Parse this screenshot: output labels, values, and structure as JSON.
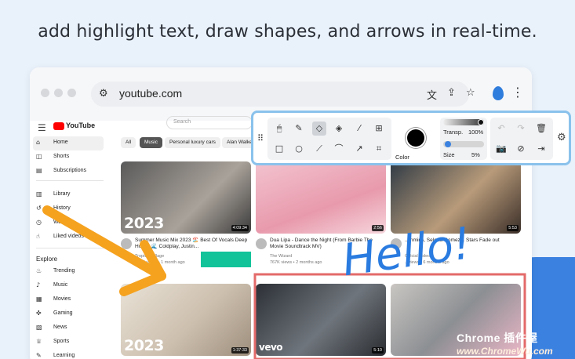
{
  "headline": "add highlight text, draw shapes, and arrows in real-time.",
  "browser": {
    "url": "youtube.com",
    "url_left_icon": "tune-icon",
    "right_icons": [
      "translate-icon",
      "share-icon",
      "star-icon",
      "extension-drop-icon",
      "more-vert-icon"
    ]
  },
  "youtube": {
    "logo_text": "YouTube",
    "search_placeholder": "Search",
    "sidebar": {
      "main": [
        {
          "label": "Home",
          "icon": "home-icon",
          "glyph": "⌂"
        },
        {
          "label": "Shorts",
          "icon": "shorts-icon",
          "glyph": "◫"
        },
        {
          "label": "Subscriptions",
          "icon": "subscriptions-icon",
          "glyph": "▤"
        }
      ],
      "library": [
        {
          "label": "Library",
          "icon": "library-icon",
          "glyph": "▥"
        },
        {
          "label": "History",
          "icon": "history-icon",
          "glyph": "↺"
        },
        {
          "label": "Watch",
          "icon": "watch-later-icon",
          "glyph": "◷"
        },
        {
          "label": "Liked videos",
          "icon": "like-icon",
          "glyph": "☝"
        }
      ],
      "explore_heading": "Explore",
      "explore": [
        {
          "label": "Trending",
          "icon": "trending-icon",
          "glyph": "♨"
        },
        {
          "label": "Music",
          "icon": "music-icon",
          "glyph": "♪"
        },
        {
          "label": "Movies",
          "icon": "movies-icon",
          "glyph": "▦"
        },
        {
          "label": "Gaming",
          "icon": "gaming-icon",
          "glyph": "✜"
        },
        {
          "label": "News",
          "icon": "news-icon",
          "glyph": "▧"
        },
        {
          "label": "Sports",
          "icon": "sports-icon",
          "glyph": "♕"
        },
        {
          "label": "Learning",
          "icon": "learning-icon",
          "glyph": "✎"
        }
      ]
    },
    "chips": [
      "All",
      "Music",
      "Personal luxury cars",
      "Alan Walker"
    ],
    "videos": [
      {
        "title": "Summer Music Mix 2023 🏖️ Best Of Vocals Deep House 🌊 Coldplay, Justin...",
        "channel": "Tropical Village",
        "meta": "271K views • 1 month ago",
        "duration": "4:09:34",
        "overlay": "2023"
      },
      {
        "title": "Dua Lipa - Dance the Night (From Barbie The Movie Soundtrack MV)",
        "channel": "The Wizard",
        "meta": "767K views • 2 months ago",
        "duration": "2:56",
        "overlay": ""
      },
      {
        "title": "...inmins, Selena Gomez... Stars Fade out",
        "channel": "Official Video",
        "meta": "...views • 6 months ago",
        "duration": "5:53",
        "overlay": ""
      },
      {
        "title": "",
        "channel": "",
        "meta": "",
        "duration": "1:37:33",
        "overlay": "2023"
      },
      {
        "title": "",
        "channel": "",
        "meta": "",
        "duration": "5:10",
        "overlay": "vevo"
      },
      {
        "title": "",
        "channel": "",
        "meta": "",
        "duration": "",
        "overlay": ""
      }
    ]
  },
  "toolbar": {
    "tools_row1": [
      "mouse-icon",
      "pencil-icon",
      "eraser-icon",
      "fill-icon",
      "eyedropper-icon",
      "text-box-icon"
    ],
    "tools_row2": [
      "square-icon",
      "circle-icon",
      "line-icon",
      "curve-icon",
      "arrow-curve-icon",
      "crop-icon"
    ],
    "color_label": "Color",
    "color_value": "#000000",
    "transparency_label": "Transp.",
    "transparency_value": "100%",
    "transparency_level": 1.0,
    "size_label": "Size",
    "size_value": "5%",
    "size_level": 0.05,
    "actions_row1": [
      "undo-icon",
      "redo-icon",
      "trash-icon"
    ],
    "actions_row2": [
      "camera-icon",
      "hide-icon",
      "exit-icon"
    ],
    "settings_icon": "gear-icon"
  },
  "annotations": {
    "hello_text": "Hello!",
    "arrow_color": "#f5a21f",
    "hello_color": "#2a7be0",
    "rect_color": "#e36a6a",
    "highlight_color": "#12c39a"
  },
  "watermark": {
    "title": "Chrome 插件屋",
    "url": "www.ChromeWu.com"
  }
}
